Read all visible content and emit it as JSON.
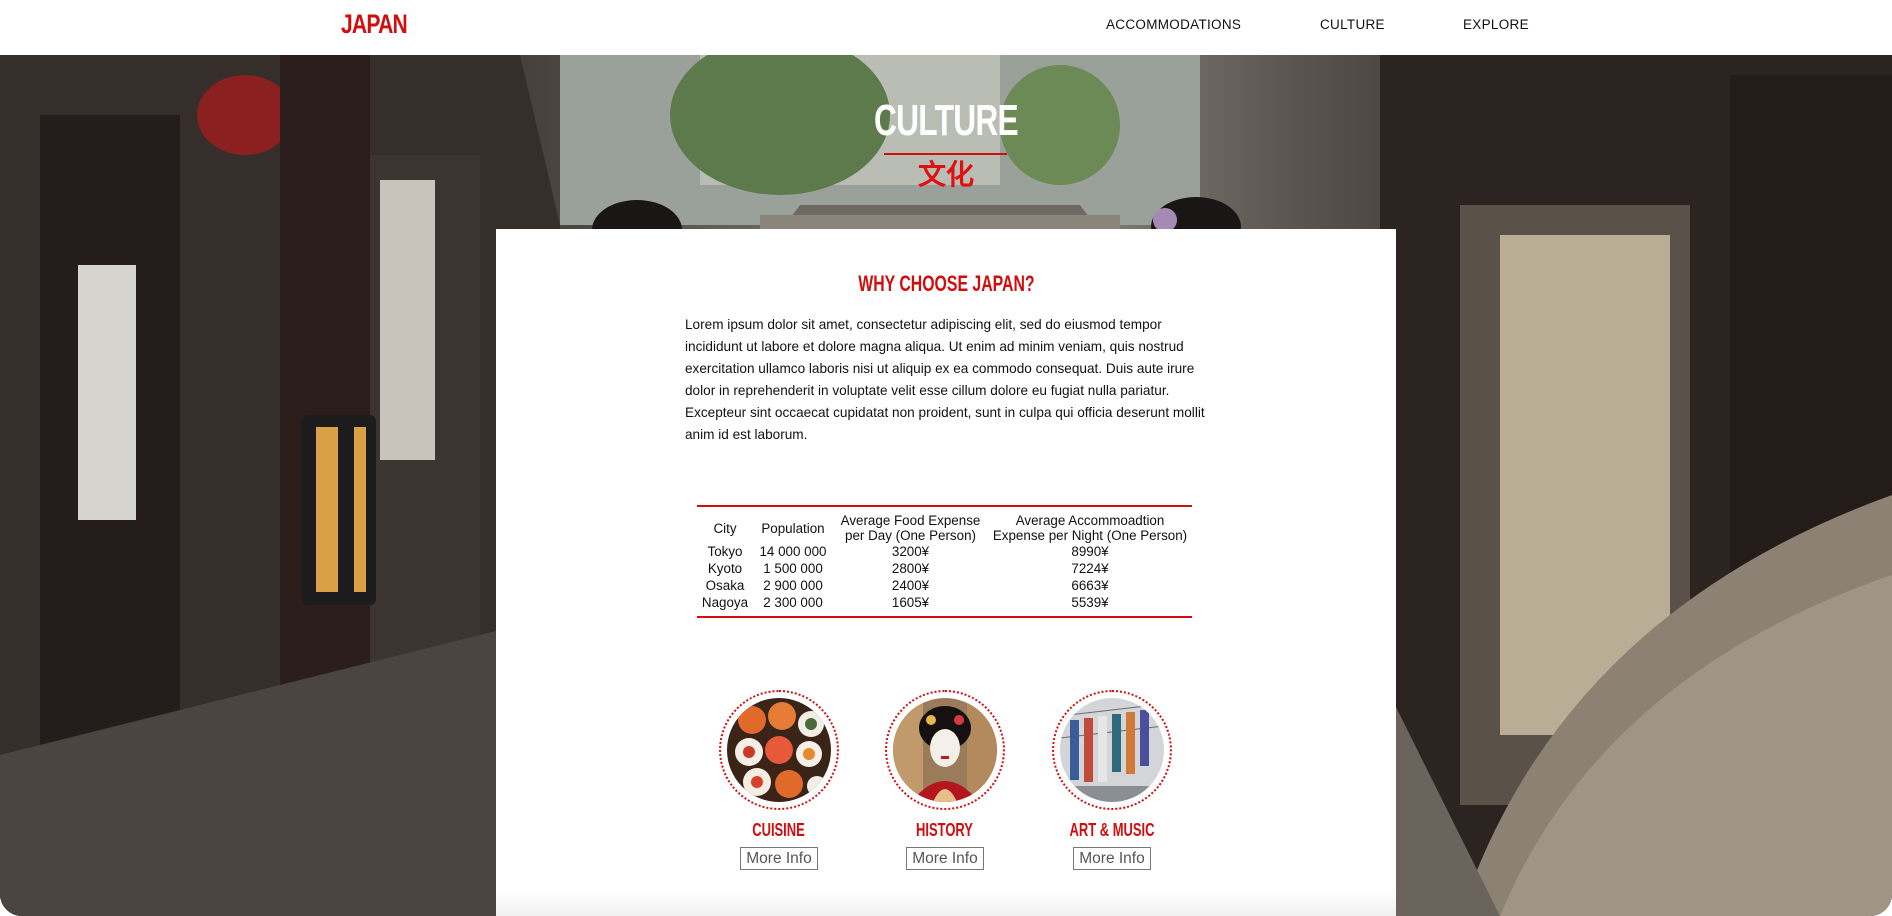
{
  "nav": {
    "logo": "JAPAN",
    "links": [
      "ACCOMMODATIONS",
      "CULTURE",
      "EXPLORE"
    ]
  },
  "hero": {
    "title": "CULTURE",
    "subtitle": "文化"
  },
  "intro": {
    "heading": "WHY CHOOSE JAPAN?",
    "paragraph": "Lorem ipsum dolor sit amet, consectetur adipiscing elit, sed do eiusmod tempor incididunt ut labore et dolore magna aliqua. Ut enim ad minim veniam, quis nostrud exercitation ullamco laboris nisi ut aliquip ex ea commodo consequat. Duis aute irure dolor in reprehenderit in voluptate velit esse cillum dolore eu fugiat nulla pariatur. Excepteur sint occaecat cupidatat non proident, sunt in culpa qui officia deserunt mollit anim id est laborum."
  },
  "table": {
    "headers": [
      "City",
      "Population",
      "Average Food Expense per Day (One Person)",
      "Average Accommoadtion Expense per Night (One Person)"
    ],
    "rows": [
      [
        "Tokyo",
        "14 000 000",
        "3200¥",
        "8990¥"
      ],
      [
        "Kyoto",
        "1 500 000",
        "2800¥",
        "7224¥"
      ],
      [
        "Osaka",
        "2 900 000",
        "2400¥",
        "6663¥"
      ],
      [
        "Nagoya",
        "2 300 000",
        "1605¥",
        "5539¥"
      ]
    ]
  },
  "cards": [
    {
      "title": "CUISINE",
      "button": "More Info",
      "image_icon": "sushi-photo"
    },
    {
      "title": "HISTORY",
      "button": "More Info",
      "image_icon": "geisha-photo"
    },
    {
      "title": "ART & MUSIC",
      "button": "More Info",
      "image_icon": "koinobori-photo"
    }
  ],
  "colors": {
    "accent": "#d10d0d",
    "text": "#111111",
    "panel": "#ffffff"
  }
}
